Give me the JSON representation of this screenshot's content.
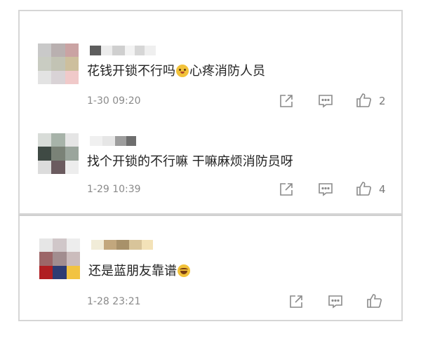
{
  "comments": [
    {
      "text_before": "花钱开锁不行吗",
      "emoji": "dog-face",
      "text_after": "心疼消防人员",
      "time": "1-30 09:20",
      "likes": "2"
    },
    {
      "text_before": "找个开锁的不行嘛 干嘛麻烦消防员呀",
      "emoji": "",
      "text_after": "",
      "time": "1-29 10:39",
      "likes": "4"
    },
    {
      "text_before": "还是蓝朋友靠谱",
      "emoji": "laughing-face",
      "text_after": "",
      "time": "1-28 23:21",
      "likes": ""
    }
  ],
  "icons": {
    "share": "share-icon",
    "reply": "comment-icon",
    "like": "thumbs-up-icon"
  },
  "colors": {
    "text": "#222222",
    "meta": "#8a8a8a",
    "icon": "#8a8a8a",
    "border": "#d6d6d6"
  }
}
